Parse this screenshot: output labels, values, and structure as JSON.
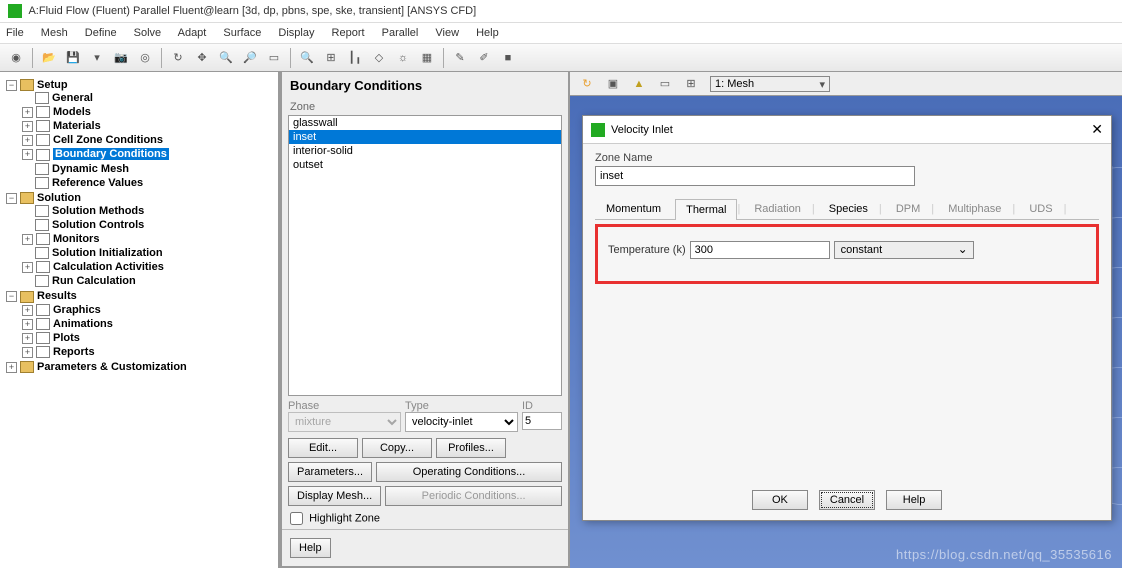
{
  "title": "A:Fluid Flow (Fluent) Parallel Fluent@learn  [3d, dp, pbns, spe, ske, transient] [ANSYS CFD]",
  "menus": [
    "File",
    "Mesh",
    "Define",
    "Solve",
    "Adapt",
    "Surface",
    "Display",
    "Report",
    "Parallel",
    "View",
    "Help"
  ],
  "tree": {
    "setup": "Setup",
    "setup_items": [
      "General",
      "Models",
      "Materials",
      "Cell Zone Conditions",
      "Boundary Conditions",
      "Dynamic Mesh",
      "Reference Values"
    ],
    "solution": "Solution",
    "solution_items": [
      "Solution Methods",
      "Solution Controls",
      "Monitors",
      "Solution Initialization",
      "Calculation Activities",
      "Run Calculation"
    ],
    "results": "Results",
    "results_items": [
      "Graphics",
      "Animations",
      "Plots",
      "Reports"
    ],
    "params": "Parameters & Customization"
  },
  "bc": {
    "title": "Boundary Conditions",
    "zone_label": "Zone",
    "zones": [
      "glasswall",
      "inset",
      "interior-solid",
      "outset"
    ],
    "selected_zone": "inset",
    "phase_label": "Phase",
    "phase": "mixture",
    "type_label": "Type",
    "type": "velocity-inlet",
    "id_label": "ID",
    "id": "5",
    "buttons1": [
      "Edit...",
      "Copy...",
      "Profiles..."
    ],
    "buttons2": [
      "Parameters...",
      "Operating Conditions..."
    ],
    "buttons3": [
      "Display Mesh...",
      "Periodic Conditions..."
    ],
    "highlight": "Highlight Zone",
    "help": "Help"
  },
  "mesh_dropdown": "1: Mesh",
  "dialog": {
    "title": "Velocity Inlet",
    "zone_name_label": "Zone Name",
    "zone_name": "inset",
    "tabs": [
      "Momentum",
      "Thermal",
      "Radiation",
      "Species",
      "DPM",
      "Multiphase",
      "UDS"
    ],
    "active_tab": "Thermal",
    "temp_label": "Temperature (k)",
    "temp_value": "300",
    "temp_mode": "constant",
    "buttons": [
      "OK",
      "Cancel",
      "Help"
    ]
  },
  "watermark": "https://blog.csdn.net/qq_35535616"
}
